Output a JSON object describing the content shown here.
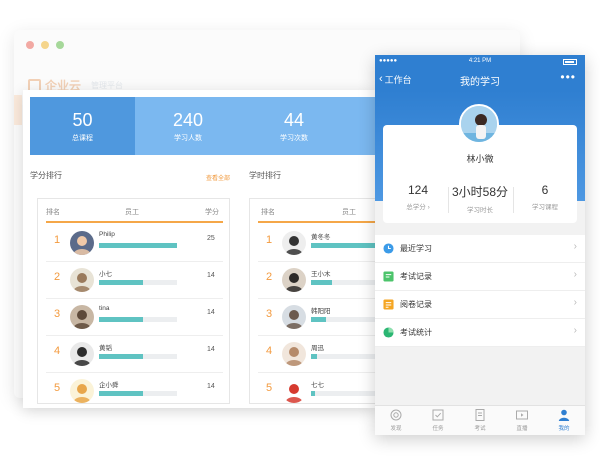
{
  "background_window": {
    "dot_colors": [
      "#f2a9a3",
      "#f5d58c",
      "#a6d89a"
    ],
    "logo_text": "企业云",
    "logo_sub": "管理平台"
  },
  "dashboard": {
    "stats": [
      {
        "value": "50",
        "label": "总课程"
      },
      {
        "value": "240",
        "label": "学习人数"
      },
      {
        "value": "44",
        "label": "学习次数"
      },
      {
        "value": "",
        "label": ""
      }
    ],
    "credit_ranking": {
      "title": "学分排行",
      "view_all": "查看全部",
      "headers": {
        "rank": "排名",
        "employee": "员工",
        "score": "学分"
      },
      "rows": [
        {
          "rank": "1",
          "name": "Philip",
          "score": "25",
          "progress": 1.0
        },
        {
          "rank": "2",
          "name": "小七",
          "score": "14",
          "progress": 0.56
        },
        {
          "rank": "3",
          "name": "tina",
          "score": "14",
          "progress": 0.56
        },
        {
          "rank": "4",
          "name": "黄韬",
          "score": "14",
          "progress": 0.56
        },
        {
          "rank": "5",
          "name": "企小舜",
          "score": "14",
          "progress": 0.56
        }
      ]
    },
    "time_ranking": {
      "title": "学时排行",
      "headers": {
        "rank": "排名",
        "employee": "员工"
      },
      "rows": [
        {
          "rank": "1",
          "name": "黄冬冬",
          "progress": 1.0
        },
        {
          "rank": "2",
          "name": "王小木",
          "progress": 0.3
        },
        {
          "rank": "3",
          "name": "韩阳阳",
          "progress": 0.22
        },
        {
          "rank": "4",
          "name": "周迅",
          "progress": 0.08
        },
        {
          "rank": "5",
          "name": "七七",
          "progress": 0.05
        }
      ]
    }
  },
  "phone": {
    "status": {
      "signal": "●●●●● ",
      "time": "4:21 PM"
    },
    "nav": {
      "back_label": "工作台",
      "title": "我的学习",
      "more": "•••"
    },
    "profile": {
      "name": "林小微",
      "metrics": [
        {
          "value": "124",
          "label": "总学分",
          "arrow": "›"
        },
        {
          "value": "3小时58分",
          "label": "学习时长"
        },
        {
          "value": "6",
          "label": "学习课程"
        }
      ]
    },
    "menu": [
      {
        "label": "最近学习",
        "icon": "clock-icon",
        "color": "#3b9be8"
      },
      {
        "label": "考试记录",
        "icon": "exam-record-icon",
        "color": "#4cc46b"
      },
      {
        "label": "阅卷记录",
        "icon": "grading-record-icon",
        "color": "#f5a623"
      },
      {
        "label": "考试统计",
        "icon": "pie-chart-icon",
        "color": "#2bb673"
      }
    ],
    "tabs": [
      {
        "label": "发现",
        "icon": "discover-icon"
      },
      {
        "label": "任务",
        "icon": "task-icon"
      },
      {
        "label": "考试",
        "icon": "exam-icon"
      },
      {
        "label": "直播",
        "icon": "live-icon"
      },
      {
        "label": "我的",
        "icon": "profile-icon",
        "active": true
      }
    ],
    "accent": "#2f7fd1"
  }
}
